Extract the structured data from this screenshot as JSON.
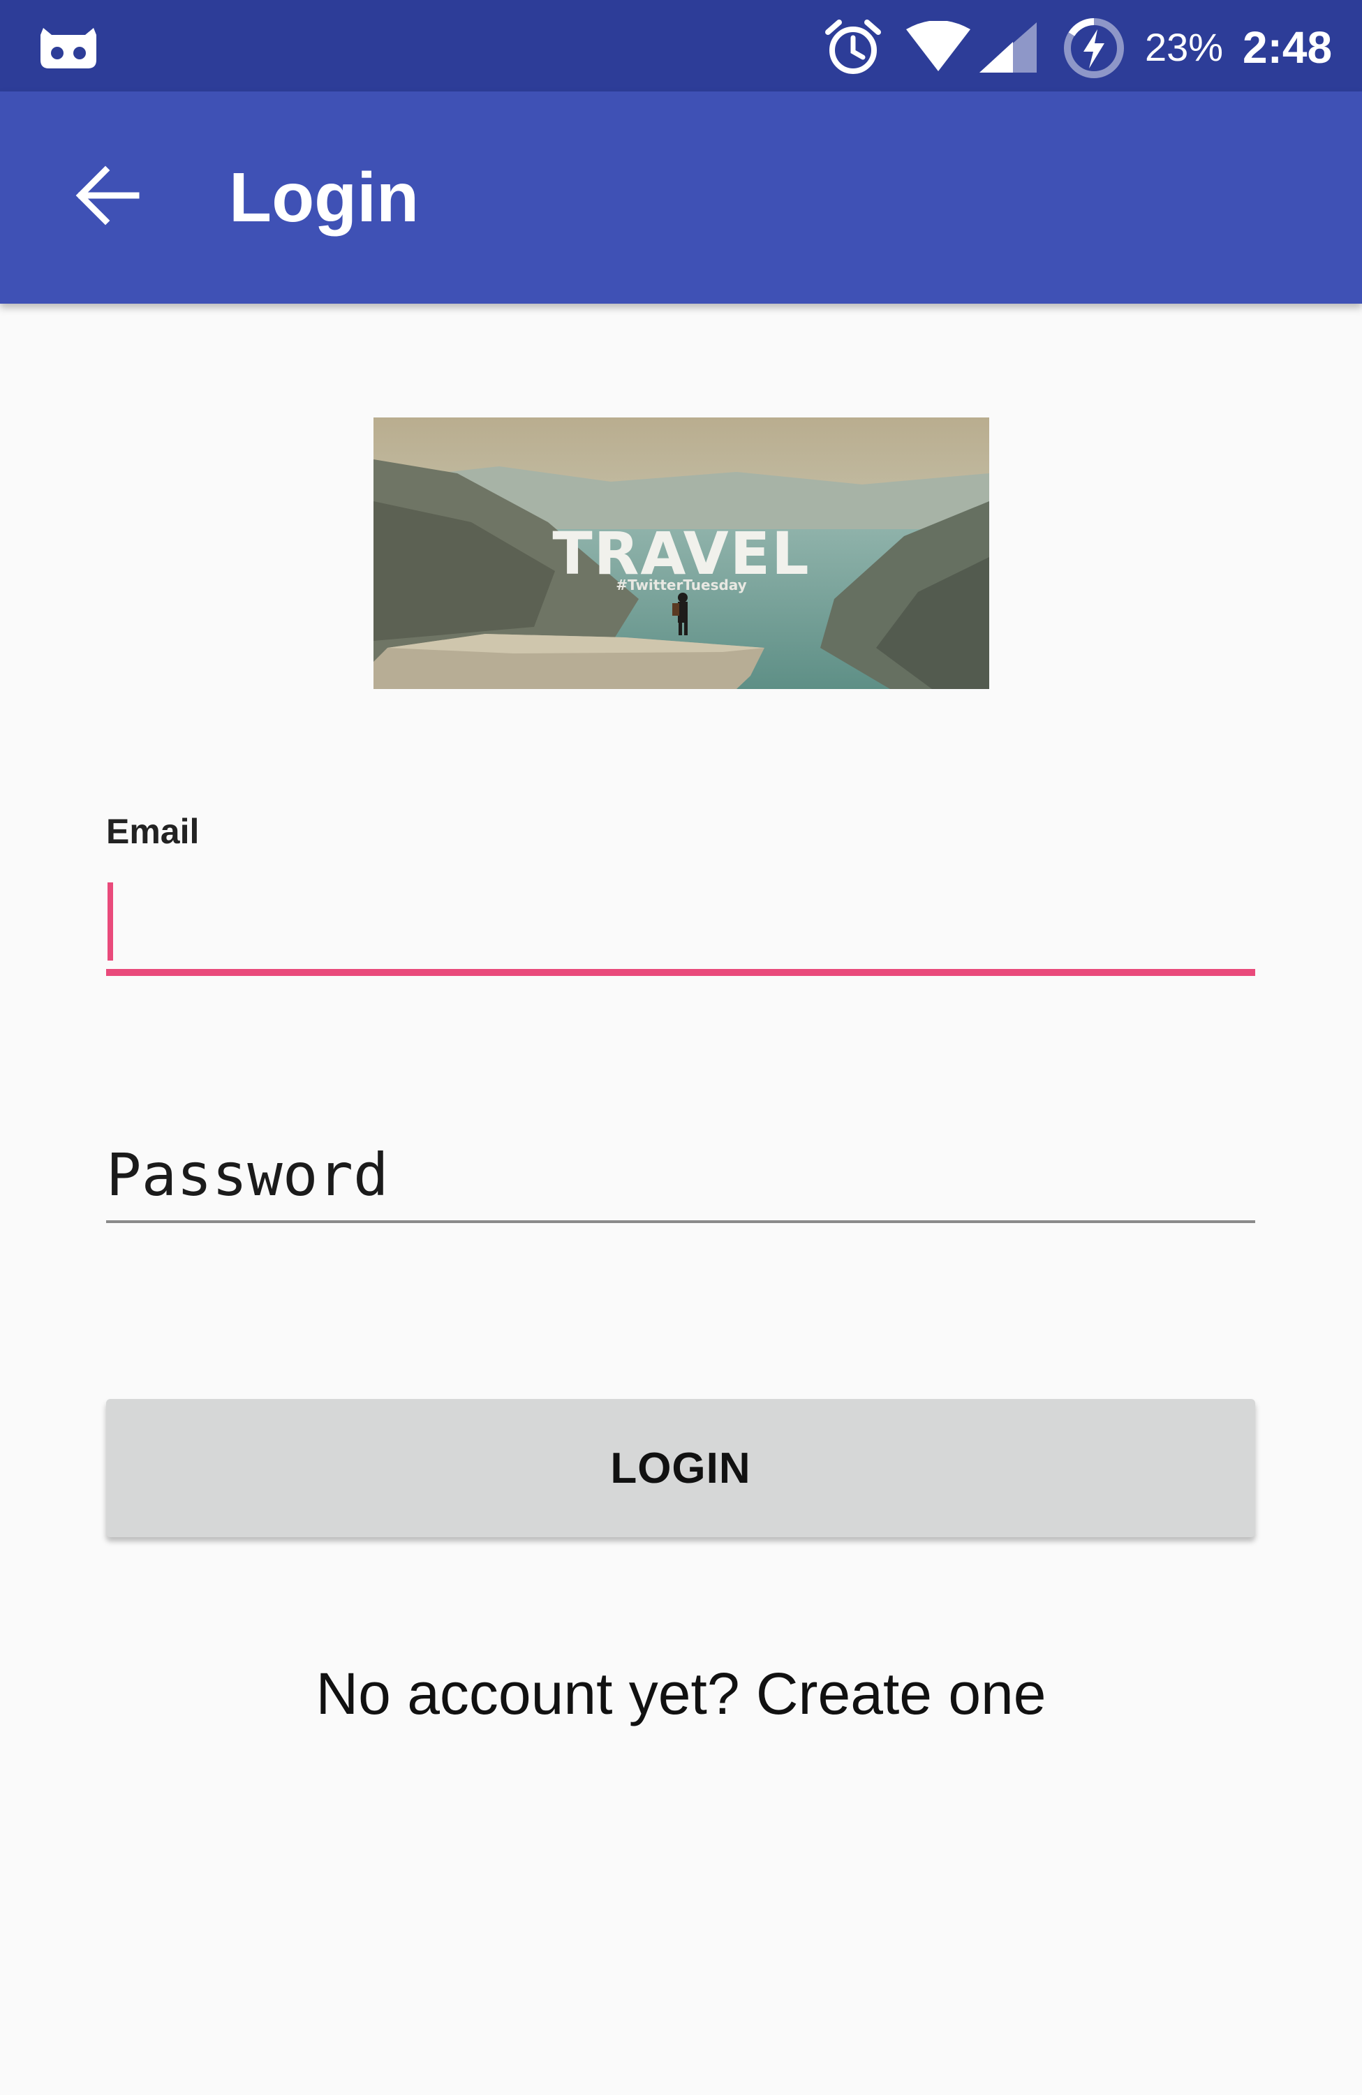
{
  "status_bar": {
    "notification_icon": "cyanogen-bot-icon",
    "alarm_icon": "alarm-clock-icon",
    "wifi_icon": "wifi-icon",
    "signal_icon": "cell-signal-icon",
    "battery_icon": "battery-charging-icon",
    "battery_percent": "23%",
    "time": "2:48",
    "background_color": "#2d3d98"
  },
  "toolbar": {
    "back_icon": "arrow-back-icon",
    "title": "Login",
    "background_color": "#3f51b5"
  },
  "header_image": {
    "title": "TRAVEL",
    "subtitle": "#TwitterTuesday"
  },
  "form": {
    "email_label": "Email",
    "email_value": "",
    "password_placeholder": "Password",
    "password_value": "",
    "login_button_label": "LOGIN",
    "create_account_text": "No account yet? Create one",
    "accent_color": "#e94a7b"
  }
}
